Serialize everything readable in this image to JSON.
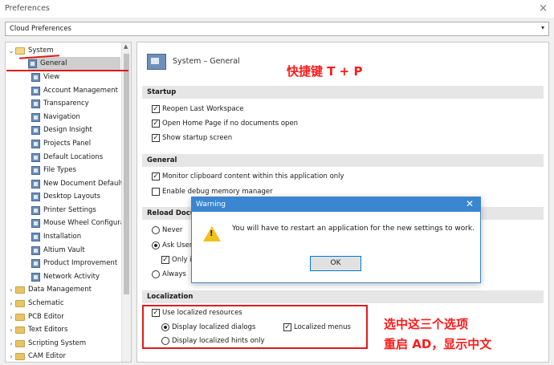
{
  "window": {
    "title": "Preferences",
    "close_glyph": "×"
  },
  "cloud_select": {
    "value": "Cloud Preferences",
    "arrow": "▾"
  },
  "tree": {
    "root": {
      "label": "System",
      "expand": "⌄"
    },
    "children": [
      "General",
      "View",
      "Account Management",
      "Transparency",
      "Navigation",
      "Design Insight",
      "Projects Panel",
      "Default Locations",
      "File Types",
      "New Document Defaults",
      "Desktop Layouts",
      "Printer Settings",
      "Mouse Wheel Configura",
      "Installation",
      "Altium Vault",
      "Product Improvement",
      "Network Activity"
    ],
    "selected": "General",
    "collapsed": [
      "Data Management",
      "Schematic",
      "PCB Editor",
      "Text Editors",
      "Scripting System",
      "CAM Editor"
    ],
    "collapsed_expand": "›"
  },
  "content": {
    "header": "System – General",
    "startup": {
      "title": "Startup",
      "options": [
        "Reopen Last Workspace",
        "Open Home Page if no documents open",
        "Show startup screen"
      ]
    },
    "general": {
      "title": "General",
      "options": [
        "Monitor clipboard content within this application only",
        "Enable debug memory manager"
      ]
    },
    "reload": {
      "title": "Reload Docum",
      "never": "Never",
      "ask_user": "Ask User",
      "only_if": "Only if",
      "always": "Always"
    },
    "localization": {
      "title": "Localization",
      "use_localized": "Use localized resources",
      "display_dialogs": "Display localized dialogs",
      "localized_menus": "Localized menus",
      "display_hints": "Display localized hints only"
    }
  },
  "dialog": {
    "title": "Warning",
    "close_glyph": "✕",
    "icon": "warning-triangle-icon",
    "message": "You will have to restart an application for the new settings to work.",
    "ok_label": "OK"
  },
  "annotations": {
    "shortcut": "快捷键 T + P",
    "select_three": "选中这三个选项",
    "restart": "重启 AD，显示中文",
    "color": "#ff1a1a"
  }
}
